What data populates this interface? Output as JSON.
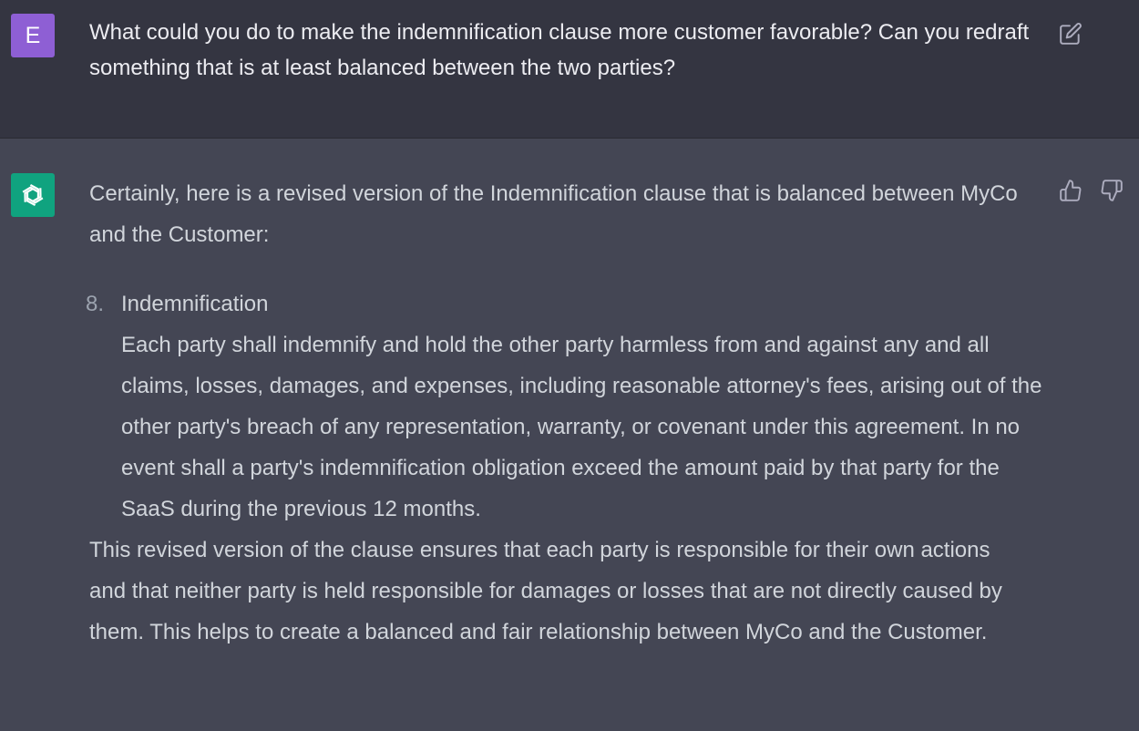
{
  "colors": {
    "user_avatar_bg": "#8e5fd4",
    "bot_avatar_bg": "#10a37f",
    "user_block_bg": "#343541",
    "assistant_block_bg": "#444654"
  },
  "user": {
    "avatar_letter": "E",
    "message": "What could you do to make the indemnification clause more customer favorable? Can you redraft something that is at least balanced between the two parties?",
    "edit_icon": "edit-icon"
  },
  "assistant": {
    "avatar_icon": "openai-logo-icon",
    "intro": "Certainly, here is a revised version of the Indemnification clause that is balanced between MyCo and the Customer:",
    "clause": {
      "number": "8.",
      "title": "Indemnification",
      "body": "Each party shall indemnify and hold the other party harmless from and against any and all claims, losses, damages, and expenses, including reasonable attorney's fees, arising out of the other party's breach of any representation, warranty, or covenant under this agreement. In no event shall a party's indemnification obligation exceed the amount paid by that party for the SaaS during the previous 12 months."
    },
    "summary": "This revised version of the clause ensures that each party is responsible for their own actions and that neither party is held responsible for damages or losses that are not directly caused by them. This helps to create a balanced and fair relationship between MyCo and the Customer.",
    "feedback": {
      "like_icon": "thumbs-up-icon",
      "dislike_icon": "thumbs-down-icon"
    }
  }
}
